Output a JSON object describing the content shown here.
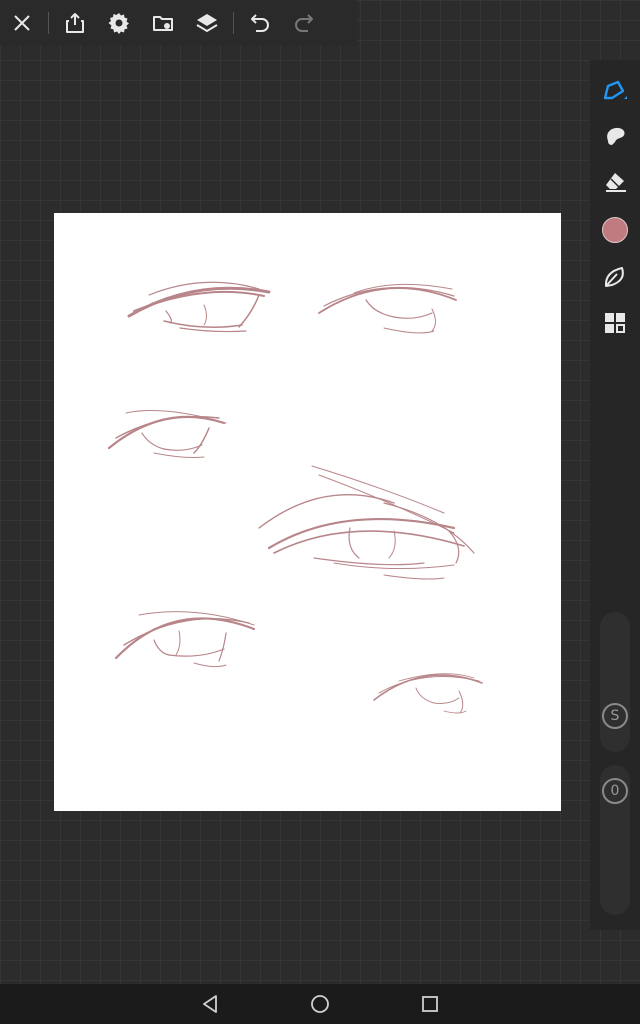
{
  "toolbar": {
    "icons": [
      "close-icon",
      "share-icon",
      "gear-icon",
      "gallery-icon",
      "layers-icon",
      "undo-icon",
      "redo-icon"
    ]
  },
  "tools": {
    "icons": [
      "pen-icon",
      "smudge-icon",
      "eraser-icon",
      "color-swatch",
      "leaf-icon",
      "grid-icon"
    ],
    "current_color": "#c07b80",
    "active_accent": "#2196f3"
  },
  "sliders": {
    "size_label": "S",
    "opacity_label": "0"
  },
  "nav": {
    "icons": [
      "back-icon",
      "home-icon",
      "recents-icon"
    ]
  }
}
